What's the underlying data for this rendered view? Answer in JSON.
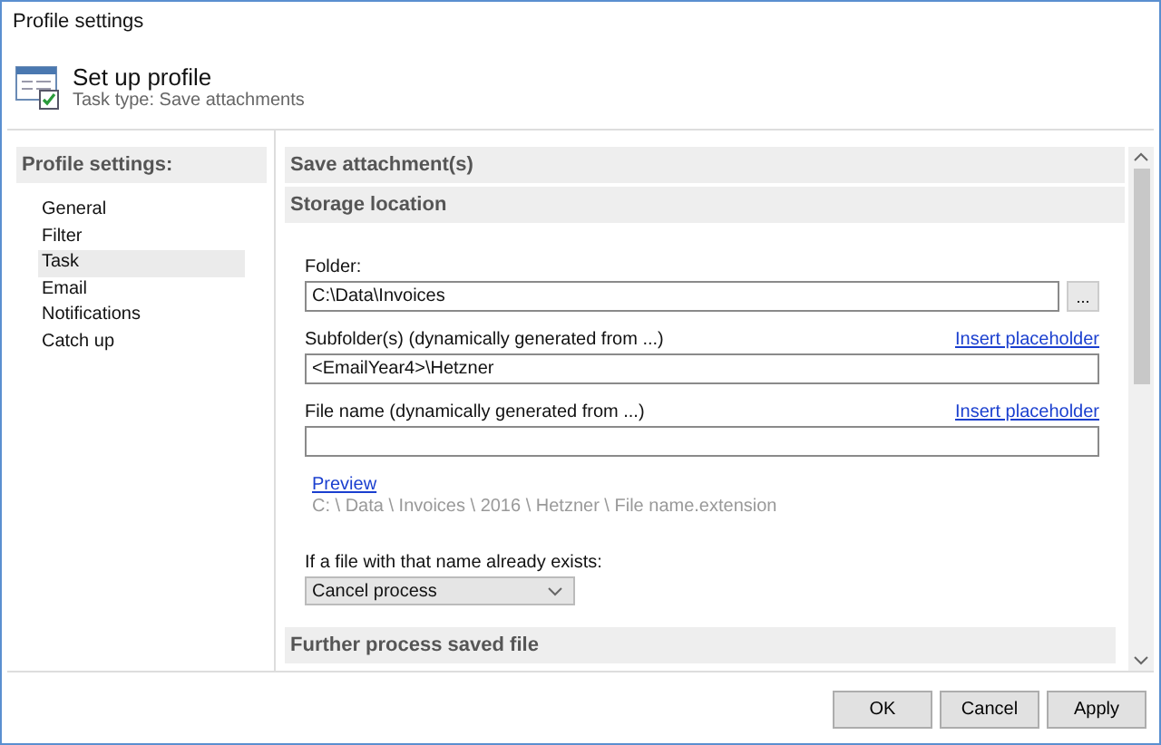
{
  "window": {
    "title": "Profile settings"
  },
  "header": {
    "title": "Set up profile",
    "subtitle": "Task type: Save attachments"
  },
  "sidebar": {
    "heading": "Profile settings:",
    "items": [
      {
        "label": "General",
        "selected": false
      },
      {
        "label": "Filter",
        "selected": false
      },
      {
        "label": "Task",
        "selected": true
      },
      {
        "label": "Email",
        "selected": false
      },
      {
        "label": "Notifications",
        "selected": false
      },
      {
        "label": "Catch up",
        "selected": false
      }
    ]
  },
  "content": {
    "heading": "Save attachment(s)",
    "section": "Storage location",
    "folder": {
      "label": "Folder:",
      "value": "C:\\Data\\Invoices",
      "browse": "..."
    },
    "subfolder": {
      "label": "Subfolder(s) (dynamically generated from ...)",
      "link": "Insert placeholder",
      "value": "<EmailYear4>\\Hetzner"
    },
    "file_name": {
      "label": "File name (dynamically generated from ...)",
      "link": "Insert placeholder"
    },
    "preview": {
      "link": "Preview",
      "path": "C: \\ Data \\ Invoices \\ 2016 \\ Hetzner \\ File name.extension"
    },
    "exists": {
      "label": "If a file with that name already exists:",
      "value": "Cancel process"
    },
    "next_section": "Further process saved file"
  },
  "buttons": [
    "OK",
    "Cancel",
    "Apply"
  ]
}
